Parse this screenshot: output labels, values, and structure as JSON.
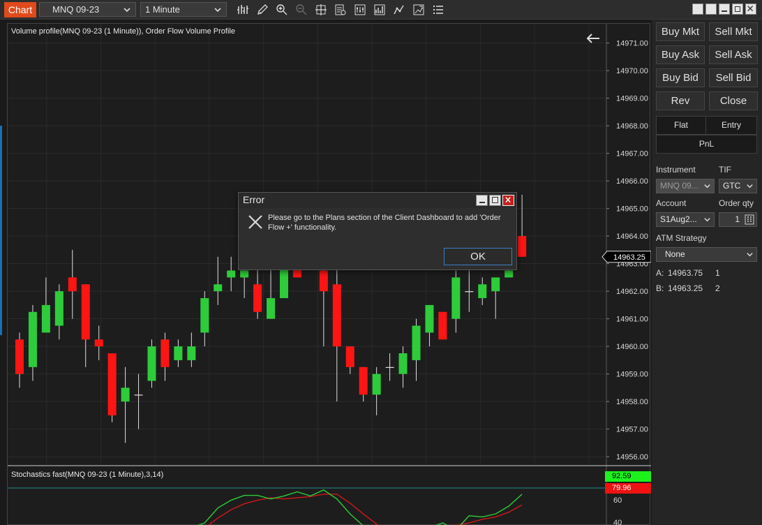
{
  "toolbar": {
    "app_tab": "Chart",
    "instrument": "MNQ 09-23",
    "interval": "1 Minute",
    "icons": [
      "bar-type-icon",
      "draw-tool-icon",
      "zoom-in-icon",
      "zoom-out-icon",
      "crosshair-icon",
      "data-box-icon",
      "properties-icon",
      "strategies-icon",
      "indicators-icon",
      "snapshot-icon",
      "list-icon"
    ]
  },
  "chart": {
    "price_panel_label": "Volume profile(MNQ 09-23 (1 Minute)), Order Flow Volume Profile",
    "stoch_panel_label": "Stochastics fast(MNQ 09-23 (1 Minute),3,14)",
    "last_price": "14963.25",
    "stoch_k_value": "92.59",
    "stoch_d_value": "79.96",
    "colors": {
      "up": "#2ecc3a",
      "down": "#ff1414",
      "bg": "#1d1d1d",
      "k_line": "#2ecc3a",
      "d_line": "#d01818",
      "ref_line": "#1f8c8c"
    }
  },
  "chart_data": {
    "type": "candlestick",
    "title": "Volume profile(MNQ 09-23 (1 Minute)), Order Flow Volume Profile",
    "ylim": [
      14955.7,
      14971.7
    ],
    "y_ticks": [
      "14971.00",
      "14970.00",
      "14969.00",
      "14968.00",
      "14967.00",
      "14966.00",
      "14965.00",
      "14964.00",
      "14963.00",
      "14962.00",
      "14961.00",
      "14960.00",
      "14959.00",
      "14958.00",
      "14957.00",
      "14956.00"
    ],
    "candles": [
      {
        "o": 14960.25,
        "h": 14960.5,
        "c": 14959.0,
        "l": 14958.5
      },
      {
        "o": 14959.25,
        "h": 14961.5,
        "c": 14961.25,
        "l": 14958.75
      },
      {
        "o": 14960.5,
        "h": 14962.5,
        "c": 14961.5,
        "l": 14960.5
      },
      {
        "o": 14960.75,
        "h": 14962.25,
        "c": 14962.0,
        "l": 14960.25
      },
      {
        "o": 14962.5,
        "h": 14963.5,
        "c": 14962.0,
        "l": 14961.0
      },
      {
        "o": 14962.25,
        "h": 14962.25,
        "c": 14960.25,
        "l": 14959.25
      },
      {
        "o": 14960.25,
        "h": 14960.75,
        "c": 14960.0,
        "l": 14959.5
      },
      {
        "o": 14959.75,
        "h": 14959.75,
        "c": 14957.5,
        "l": 14957.25
      },
      {
        "o": 14958.0,
        "h": 14959.25,
        "c": 14958.5,
        "l": 14956.5
      },
      {
        "o": 14958.25,
        "h": 14959.0,
        "c": 14958.25,
        "l": 14957.0
      },
      {
        "o": 14958.75,
        "h": 14960.25,
        "c": 14960.0,
        "l": 14958.5
      },
      {
        "o": 14960.25,
        "h": 14960.5,
        "c": 14959.25,
        "l": 14958.75
      },
      {
        "o": 14959.5,
        "h": 14960.25,
        "c": 14960.0,
        "l": 14959.25
      },
      {
        "o": 14959.5,
        "h": 14960.5,
        "c": 14960.0,
        "l": 14959.25
      },
      {
        "o": 14960.5,
        "h": 14962.0,
        "c": 14961.75,
        "l": 14960.0
      },
      {
        "o": 14962.0,
        "h": 14963.25,
        "c": 14962.25,
        "l": 14961.5
      },
      {
        "o": 14962.5,
        "h": 14963.25,
        "c": 14962.75,
        "l": 14962.0
      },
      {
        "o": 14962.5,
        "h": 14963.5,
        "c": 14962.75,
        "l": 14961.75
      },
      {
        "o": 14962.25,
        "h": 14963.0,
        "c": 14961.25,
        "l": 14961.0
      },
      {
        "o": 14961.0,
        "h": 14963.0,
        "c": 14961.75,
        "l": 14961.0
      },
      {
        "o": 14961.75,
        "h": 14963.0,
        "c": 14963.0,
        "l": 14961.75
      },
      {
        "o": 14963.0,
        "h": 14963.0,
        "c": 14962.5,
        "l": 14962.5
      },
      {
        "o": 14963.0,
        "h": 14963.0,
        "c": 14963.0,
        "l": 14963.0
      },
      {
        "o": 14962.75,
        "h": 14963.25,
        "c": 14962.0,
        "l": 14960.0
      },
      {
        "o": 14962.25,
        "h": 14963.0,
        "c": 14960.0,
        "l": 14958.0
      },
      {
        "o": 14960.0,
        "h": 14960.0,
        "c": 14959.25,
        "l": 14959.0
      },
      {
        "o": 14959.25,
        "h": 14959.25,
        "c": 14958.25,
        "l": 14958.0
      },
      {
        "o": 14958.25,
        "h": 14959.25,
        "c": 14959.0,
        "l": 14957.5
      },
      {
        "o": 14959.25,
        "h": 14959.75,
        "c": 14959.25,
        "l": 14958.75
      },
      {
        "o": 14959.0,
        "h": 14960.0,
        "c": 14959.75,
        "l": 14958.5
      },
      {
        "o": 14959.5,
        "h": 14961.0,
        "c": 14960.75,
        "l": 14958.75
      },
      {
        "o": 14960.5,
        "h": 14961.5,
        "c": 14961.5,
        "l": 14960.0
      },
      {
        "o": 14961.25,
        "h": 14961.25,
        "c": 14960.25,
        "l": 14960.25
      },
      {
        "o": 14961.0,
        "h": 14962.75,
        "c": 14962.5,
        "l": 14960.5
      },
      {
        "o": 14962.0,
        "h": 14962.75,
        "c": 14962.0,
        "l": 14961.25
      },
      {
        "o": 14961.75,
        "h": 14962.5,
        "c": 14962.25,
        "l": 14961.5
      },
      {
        "o": 14962.0,
        "h": 14962.5,
        "c": 14962.5,
        "l": 14961.0
      },
      {
        "o": 14962.5,
        "h": 14965.5,
        "c": 14962.75,
        "l": 14962.5
      },
      {
        "o": 14964.0,
        "h": 14965.5,
        "c": 14963.25,
        "l": 14963.25
      }
    ],
    "stoch_k": [
      null,
      null,
      null,
      null,
      null,
      null,
      null,
      null,
      null,
      null,
      10,
      20,
      18,
      22,
      30,
      55,
      68,
      76,
      76,
      70,
      75,
      82,
      75,
      85,
      70,
      45,
      25,
      12,
      8,
      5,
      15,
      22,
      30,
      18,
      42,
      40,
      45,
      58,
      78
    ],
    "stoch_d": [
      null,
      null,
      null,
      null,
      null,
      null,
      null,
      null,
      null,
      null,
      null,
      null,
      16,
      18,
      22,
      38,
      52,
      62,
      68,
      72,
      70,
      72,
      74,
      78,
      78,
      63,
      45,
      28,
      15,
      10,
      12,
      16,
      22,
      26,
      30,
      36,
      40,
      48,
      60
    ],
    "stoch_visible_ticks": [
      "60",
      "40"
    ]
  },
  "sidebar": {
    "buy_mkt": "Buy Mkt",
    "sell_mkt": "Sell Mkt",
    "buy_ask": "Buy Ask",
    "sell_ask": "Sell Ask",
    "buy_bid": "Buy Bid",
    "sell_bid": "Sell Bid",
    "rev": "Rev",
    "close": "Close",
    "flat": "Flat",
    "entry": "Entry",
    "pnl": "PnL",
    "instrument_label": "Instrument",
    "instrument_value": "MNQ 09...",
    "tif_label": "TIF",
    "tif_value": "GTC",
    "account_label": "Account",
    "account_value": "S1Aug2...",
    "qty_label": "Order qty",
    "qty_value": "1",
    "atm_label": "ATM Strategy",
    "atm_value": "None",
    "ask_prefix": "A:",
    "ask_price": "14963.75",
    "ask_size": "1",
    "bid_prefix": "B:",
    "bid_price": "14963.25",
    "bid_size": "2"
  },
  "dialog": {
    "title": "Error",
    "message": "Please go to the Plans section of the Client Dashboard to add 'Order Flow +' functionality.",
    "ok": "OK"
  }
}
